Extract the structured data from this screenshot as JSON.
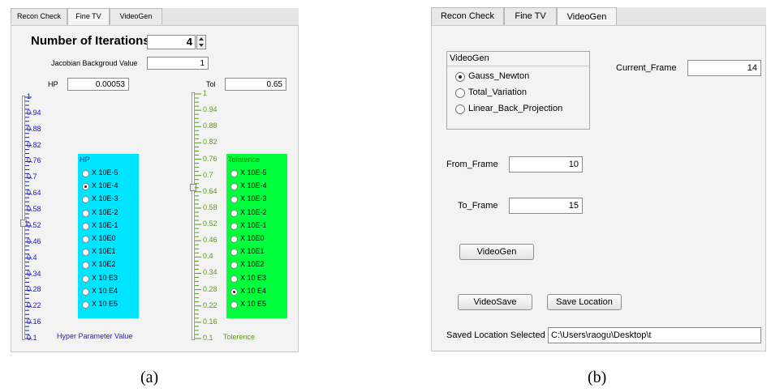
{
  "panel_a": {
    "tabs": [
      "Recon Check",
      "Fine TV",
      "VideoGen"
    ],
    "active_tab": "Fine TV",
    "iterations_label": "Number of Iterations",
    "iterations_value": "4",
    "jacobian_label": "Jacobian Backgroud Value",
    "jacobian_value": "1",
    "hp_label": "HP",
    "hp_value": "0.00053",
    "tol_label": "Tol",
    "tol_value": "0.65",
    "hp_ticks": [
      "1",
      "0.94",
      "0.88",
      "0.82",
      "0.76",
      "0.7",
      "0.64",
      "0.58",
      "0.52",
      "0.46",
      "0.4",
      "0.34",
      "0.28",
      "0.22",
      "0.16",
      "0.1"
    ],
    "tol_ticks": [
      "1",
      "0.94",
      "0.88",
      "0.82",
      "0.76",
      "0.7",
      "0.64",
      "0.58",
      "0.52",
      "0.46",
      "0.4",
      "0.34",
      "0.28",
      "0.22",
      "0.16",
      "0.1"
    ],
    "hp_group_title": "HP",
    "hp_options": [
      "X 10E-5",
      "X 10E-4",
      "X 10E-3",
      "X 10E-2",
      "X 10E-1",
      "X 10E0",
      "X 10E1",
      "X 10E2",
      "X 10 E3",
      "X 10 E4",
      "X 10 E5"
    ],
    "hp_selected_index": 1,
    "tol_group_title": "Tolerence",
    "tol_options": [
      "X 10E-5",
      "X 10E-4",
      "X 10E-3",
      "X 10E-2",
      "X 10E-1",
      "X 10E0",
      "X 10E1",
      "X 10E2",
      "X 10 E3",
      "X 10 E4",
      "X 10 E5"
    ],
    "tol_selected_index": 9,
    "hp_footer": "Hyper Parameter Value",
    "tol_footer": "Tolerence",
    "caption": "(a)",
    "colors": {
      "hp_group_bg": "#00e5ff",
      "tol_group_bg": "#00ff3c",
      "hp_ticks": "#1a1acc",
      "tol_ticks": "#5a9a1a"
    }
  },
  "panel_b": {
    "tabs": [
      "Recon Check",
      "Fine TV",
      "VideoGen"
    ],
    "active_tab": "VideoGen",
    "videogen_group_title": "VideoGen",
    "methods": [
      "Gauss_Newton",
      "Total_Variation",
      "Linear_Back_Projection"
    ],
    "method_selected_index": 0,
    "current_frame_label": "Current_Frame",
    "current_frame_value": "14",
    "from_frame_label": "From_Frame",
    "from_frame_value": "10",
    "to_frame_label": "To_Frame",
    "to_frame_value": "15",
    "videogen_button": "VideoGen",
    "videosave_button": "VideoSave",
    "save_location_button": "Save Location",
    "saved_location_label": "Saved Location Selected",
    "saved_location_value": "C:\\Users\\raogu\\Desktop\\t",
    "caption": "(b)"
  }
}
